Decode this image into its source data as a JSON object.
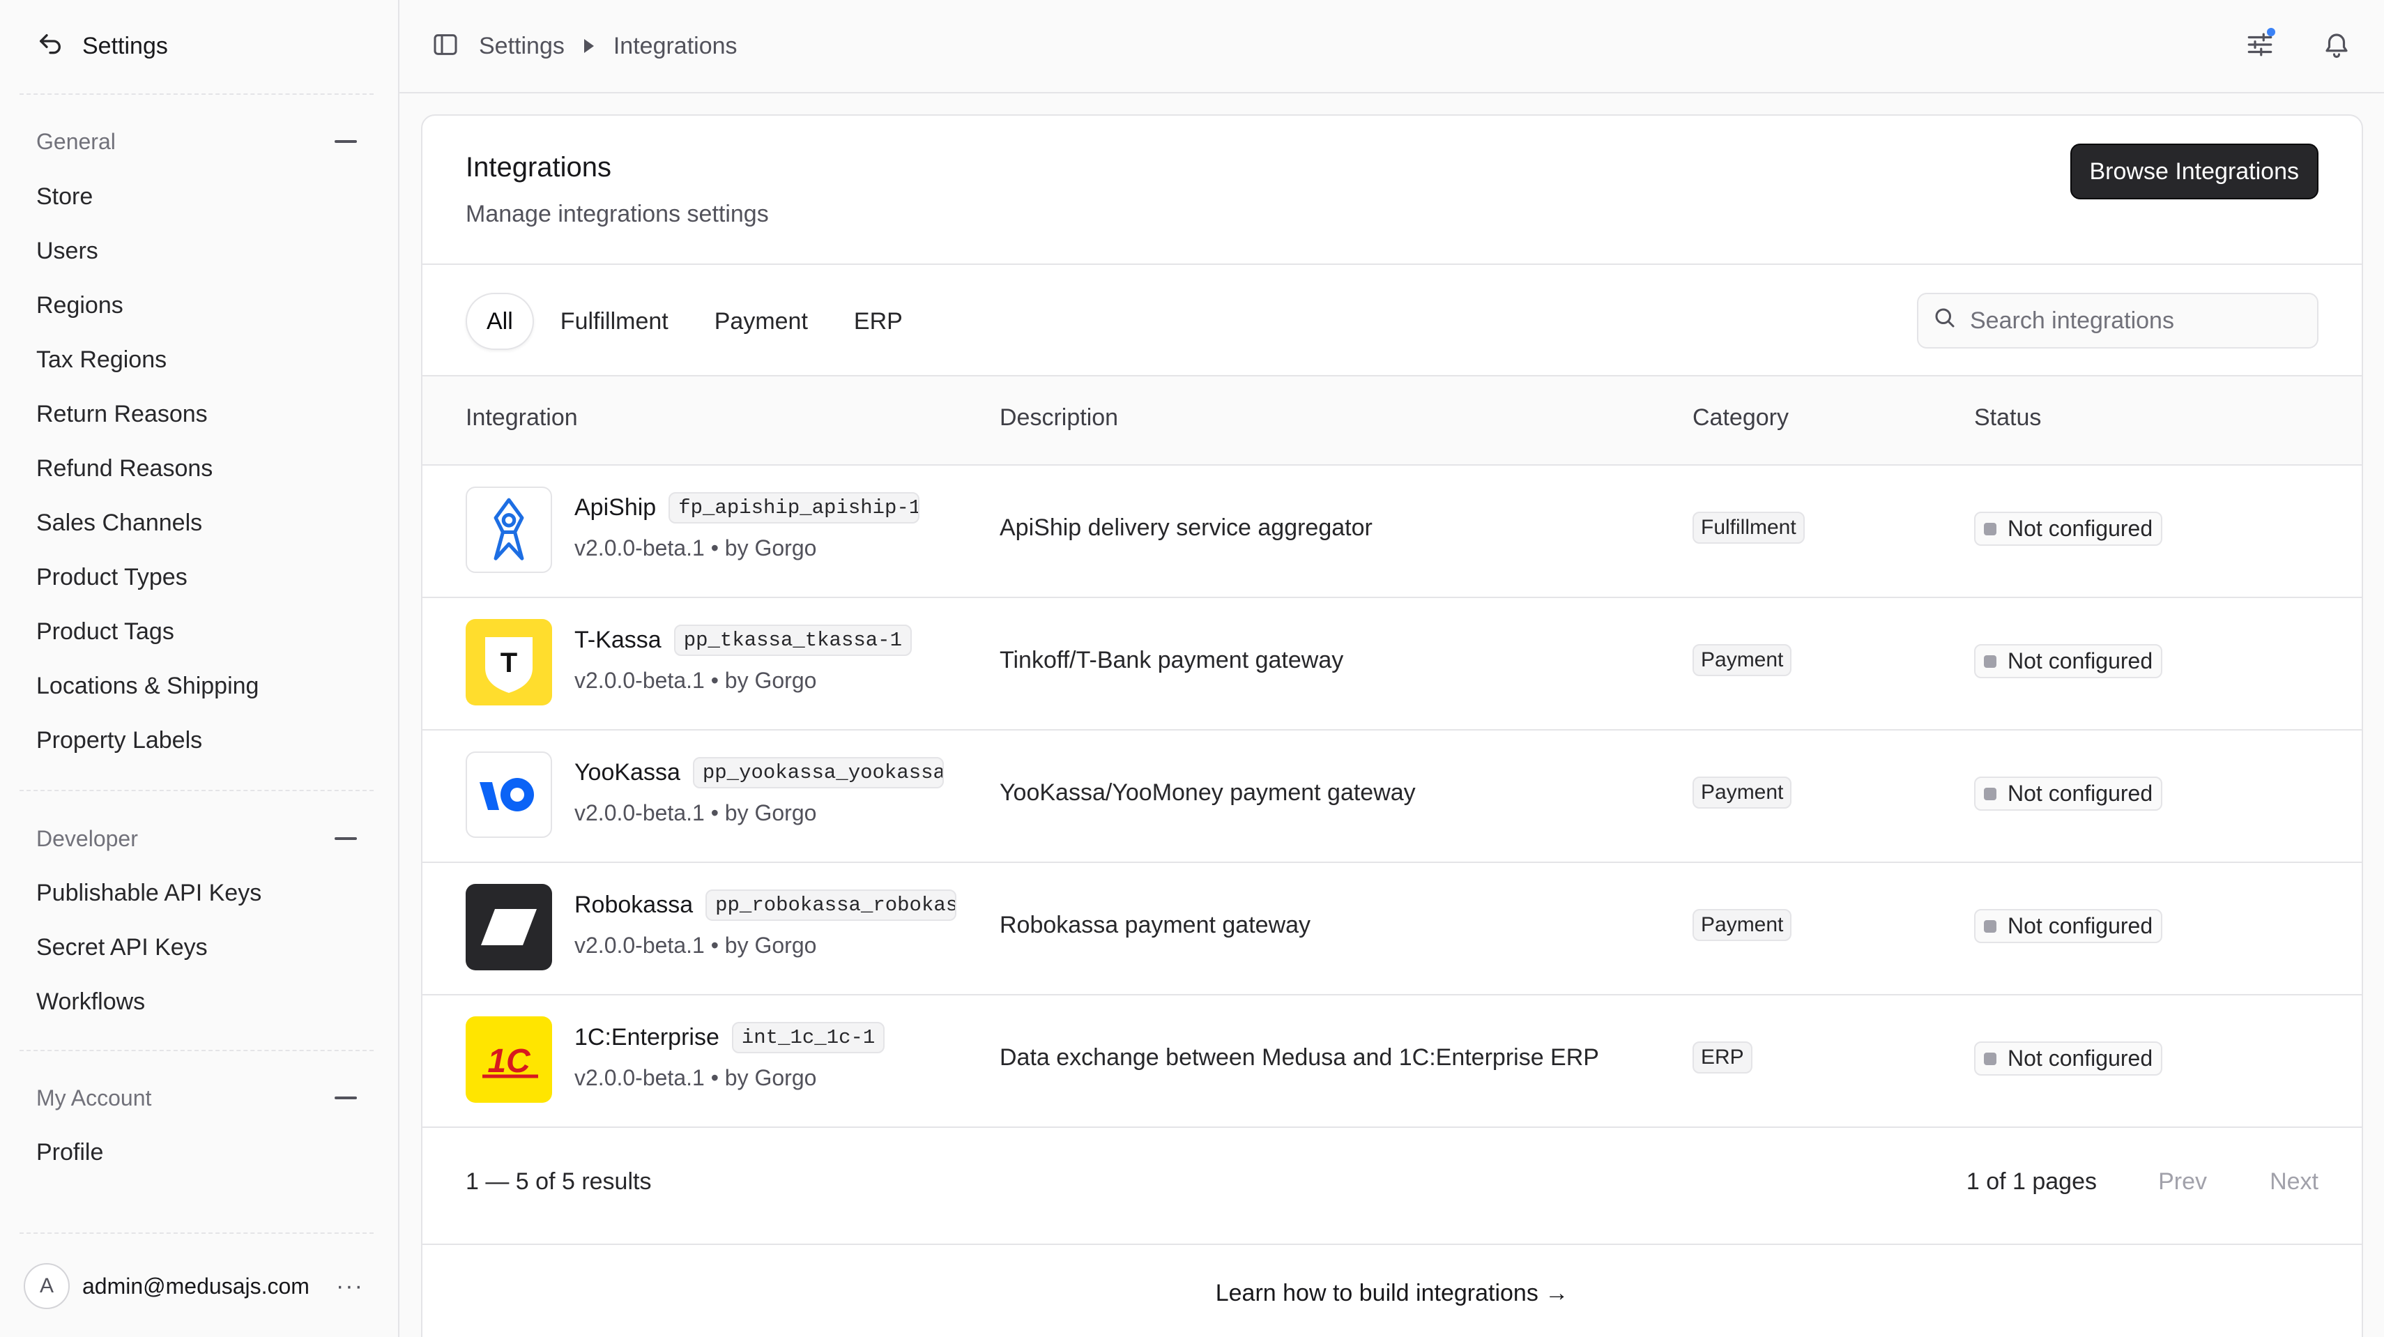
{
  "sidebar": {
    "title": "Settings",
    "sections": [
      {
        "label": "General",
        "items": [
          "Store",
          "Users",
          "Regions",
          "Tax Regions",
          "Return Reasons",
          "Refund Reasons",
          "Sales Channels",
          "Product Types",
          "Product Tags",
          "Locations & Shipping",
          "Property Labels"
        ]
      },
      {
        "label": "Developer",
        "items": [
          "Publishable API Keys",
          "Secret API Keys",
          "Workflows"
        ]
      },
      {
        "label": "My Account",
        "items": [
          "Profile"
        ]
      }
    ],
    "user": {
      "initial": "A",
      "email": "admin@medusajs.com",
      "menu": "···"
    }
  },
  "topbar": {
    "breadcrumb": [
      "Settings",
      "Integrations"
    ],
    "icons": [
      "sidebar-toggle-icon",
      "sliders-icon",
      "bell-icon"
    ],
    "accent": "#3b82f6"
  },
  "page": {
    "title": "Integrations",
    "subtitle": "Manage integrations settings",
    "browse_label": "Browse Integrations",
    "tabs": [
      "All",
      "Fulfillment",
      "Payment",
      "ERP"
    ],
    "active_tab": "All",
    "search_placeholder": "Search integrations",
    "columns": [
      "Integration",
      "Description",
      "Category",
      "Status"
    ],
    "rows": [
      {
        "name": "ApiShip",
        "code": "fp_apiship_apiship-1",
        "version": "v2.0.0-beta.1 • by Gorgo",
        "description": "ApiShip delivery service aggregator",
        "category": "Fulfillment",
        "status": "Not configured",
        "logo": "apiship-logo"
      },
      {
        "name": "T-Kassa",
        "code": "pp_tkassa_tkassa-1",
        "version": "v2.0.0-beta.1 • by Gorgo",
        "description": "Tinkoff/T-Bank payment gateway",
        "category": "Payment",
        "status": "Not configured",
        "logo": "tkassa-logo",
        "logo_text": "T"
      },
      {
        "name": "YooKassa",
        "code": "pp_yookassa_yookassa-",
        "version": "v2.0.0-beta.1 • by Gorgo",
        "description": "YooKassa/YooMoney payment gateway",
        "category": "Payment",
        "status": "Not configured",
        "logo": "yookassa-logo"
      },
      {
        "name": "Robokassa",
        "code": "pp_robokassa_robokas",
        "version": "v2.0.0-beta.1 • by Gorgo",
        "description": "Robokassa payment gateway",
        "category": "Payment",
        "status": "Not configured",
        "logo": "robokassa-logo"
      },
      {
        "name": "1C:Enterprise",
        "code": "int_1c_1c-1",
        "version": "v2.0.0-beta.1 • by Gorgo",
        "description": "Data exchange between Medusa and 1C:Enterprise ERP",
        "category": "ERP",
        "status": "Not configured",
        "logo": "1c-logo",
        "logo_text": "1С"
      }
    ],
    "pagination": {
      "results": "1 — 5 of 5 results",
      "pages": "1 of 1 pages",
      "prev": "Prev",
      "next": "Next"
    },
    "learn_link": "Learn how to build integrations →"
  }
}
